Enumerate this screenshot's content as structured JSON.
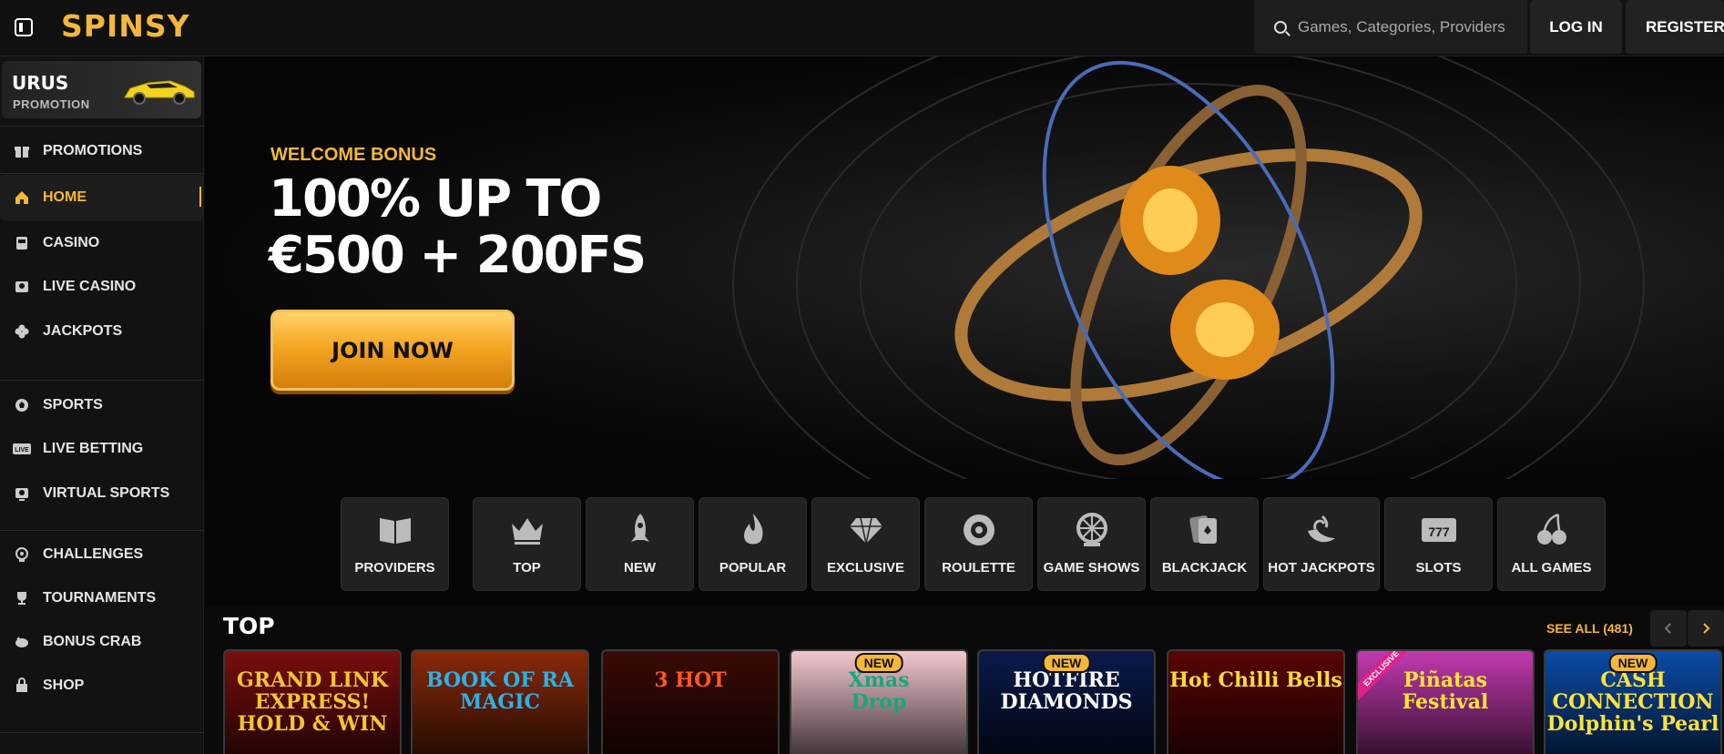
{
  "header": {
    "logo": "SPINSY",
    "search_placeholder": "Games, Categories, Providers",
    "login_label": "LOG IN",
    "register_label": "REGISTER"
  },
  "sidebar": {
    "promo": {
      "title": "URUS",
      "subtitle": "PROMOTION"
    },
    "items": [
      {
        "label": "PROMOTIONS",
        "icon": "gift-icon"
      },
      {
        "label": "HOME",
        "icon": "home-icon",
        "active": true
      },
      {
        "label": "CASINO",
        "icon": "slot-machine-icon"
      },
      {
        "label": "LIVE CASINO",
        "icon": "live-dealer-icon"
      },
      {
        "label": "JACKPOTS",
        "icon": "clover-icon"
      },
      {
        "label": "SPORTS",
        "icon": "ball-icon"
      },
      {
        "label": "LIVE BETTING",
        "icon": "live-badge-icon"
      },
      {
        "label": "VIRTUAL SPORTS",
        "icon": "virtual-icon"
      },
      {
        "label": "CHALLENGES",
        "icon": "challenge-icon"
      },
      {
        "label": "TOURNAMENTS",
        "icon": "trophy-icon"
      },
      {
        "label": "BONUS CRAB",
        "icon": "crab-icon"
      },
      {
        "label": "SHOP",
        "icon": "shop-bag-icon"
      }
    ]
  },
  "hero": {
    "kicker": "WELCOME BONUS",
    "title_line1": "100% UP TO",
    "title_line2": "€500 + 200FS",
    "cta": "JOIN NOW"
  },
  "categories": [
    {
      "label": "PROVIDERS",
      "icon": "book-icon"
    },
    {
      "label": "TOP",
      "icon": "crown-icon"
    },
    {
      "label": "NEW",
      "icon": "rocket-icon"
    },
    {
      "label": "POPULAR",
      "icon": "flame-icon"
    },
    {
      "label": "EXCLUSIVE",
      "icon": "diamond-icon"
    },
    {
      "label": "ROULETTE",
      "icon": "roulette-icon"
    },
    {
      "label": "GAME SHOWS",
      "icon": "wheel-icon"
    },
    {
      "label": "BLACKJACK",
      "icon": "cards-icon"
    },
    {
      "label": "HOT JACKPOTS",
      "icon": "chili-icon"
    },
    {
      "label": "SLOTS",
      "icon": "slots-777-icon"
    },
    {
      "label": "ALL GAMES",
      "icon": "cherries-icon"
    }
  ],
  "top_section": {
    "title": "TOP",
    "see_all": "SEE ALL (481)"
  },
  "games": [
    {
      "name": "GRAND LINK\nEXPRESS! HOLD & WIN",
      "badge": "",
      "bg": "#7a0e0e",
      "color": "#f5c431"
    },
    {
      "name": "BOOK OF RA\nMAGIC",
      "badge": "",
      "bg": "#8a2a0a",
      "color": "#2ab3e8"
    },
    {
      "name": "3 HOT",
      "badge": "",
      "bg": "#3a0a06",
      "color": "#ff5a1e"
    },
    {
      "name": "Xmas\nDrop",
      "badge": "NEW",
      "bg": "#f2c6cf",
      "color": "#16a77a"
    },
    {
      "name": "HOTFIRE\nDIAMONDS",
      "badge": "NEW",
      "bg": "#0a1a4a",
      "color": "#ffffff"
    },
    {
      "name": "Hot Chilli Bells",
      "badge": "",
      "bg": "#5a0505",
      "color": "#ffdb3a"
    },
    {
      "name": "Piñatas\nFestival",
      "badge": "EXCLUSIVE",
      "bg": "#c33ab0",
      "color": "#ffe23a"
    },
    {
      "name": "CASH CONNECTION\nDolphin's Pearl",
      "badge": "NEW",
      "bg": "#0b4ca8",
      "color": "#ffe23a"
    }
  ]
}
